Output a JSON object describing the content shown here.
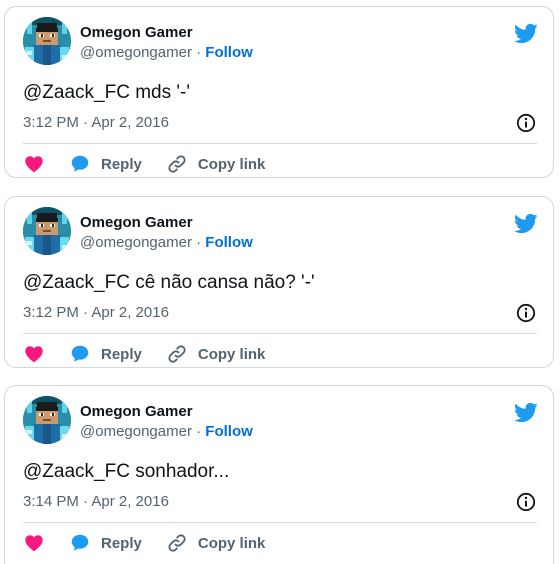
{
  "colors": {
    "follow_blue": "#006fd6",
    "twitter_blue": "#1d9bf0",
    "like_pink": "#f91880",
    "muted_gray": "#536471",
    "border_gray": "#cfd9de",
    "avatar_teal": "#2a8ea8"
  },
  "icons": {
    "brand": "twitter-bird-icon",
    "info": "info-circle-icon",
    "like": "heart-icon",
    "reply": "speech-bubble-icon",
    "copy_link": "chain-link-icon"
  },
  "tweets": [
    {
      "author_name": "Omegon Gamer",
      "handle": "@omegongamer",
      "separator": "·",
      "follow_label": "Follow",
      "text": "@Zaack_FC mds '-'",
      "time": "3:12 PM · Apr 2, 2016",
      "reply_label": "Reply",
      "copy_link_label": "Copy link"
    },
    {
      "author_name": "Omegon Gamer",
      "handle": "@omegongamer",
      "separator": "·",
      "follow_label": "Follow",
      "text": "@Zaack_FC cê não cansa não? '-'",
      "time": "3:12 PM · Apr 2, 2016",
      "reply_label": "Reply",
      "copy_link_label": "Copy link"
    },
    {
      "author_name": "Omegon Gamer",
      "handle": "@omegongamer",
      "separator": "·",
      "follow_label": "Follow",
      "text": "@Zaack_FC sonhador...",
      "time": "3:14 PM · Apr 2, 2016",
      "reply_label": "Reply",
      "copy_link_label": "Copy link"
    }
  ]
}
